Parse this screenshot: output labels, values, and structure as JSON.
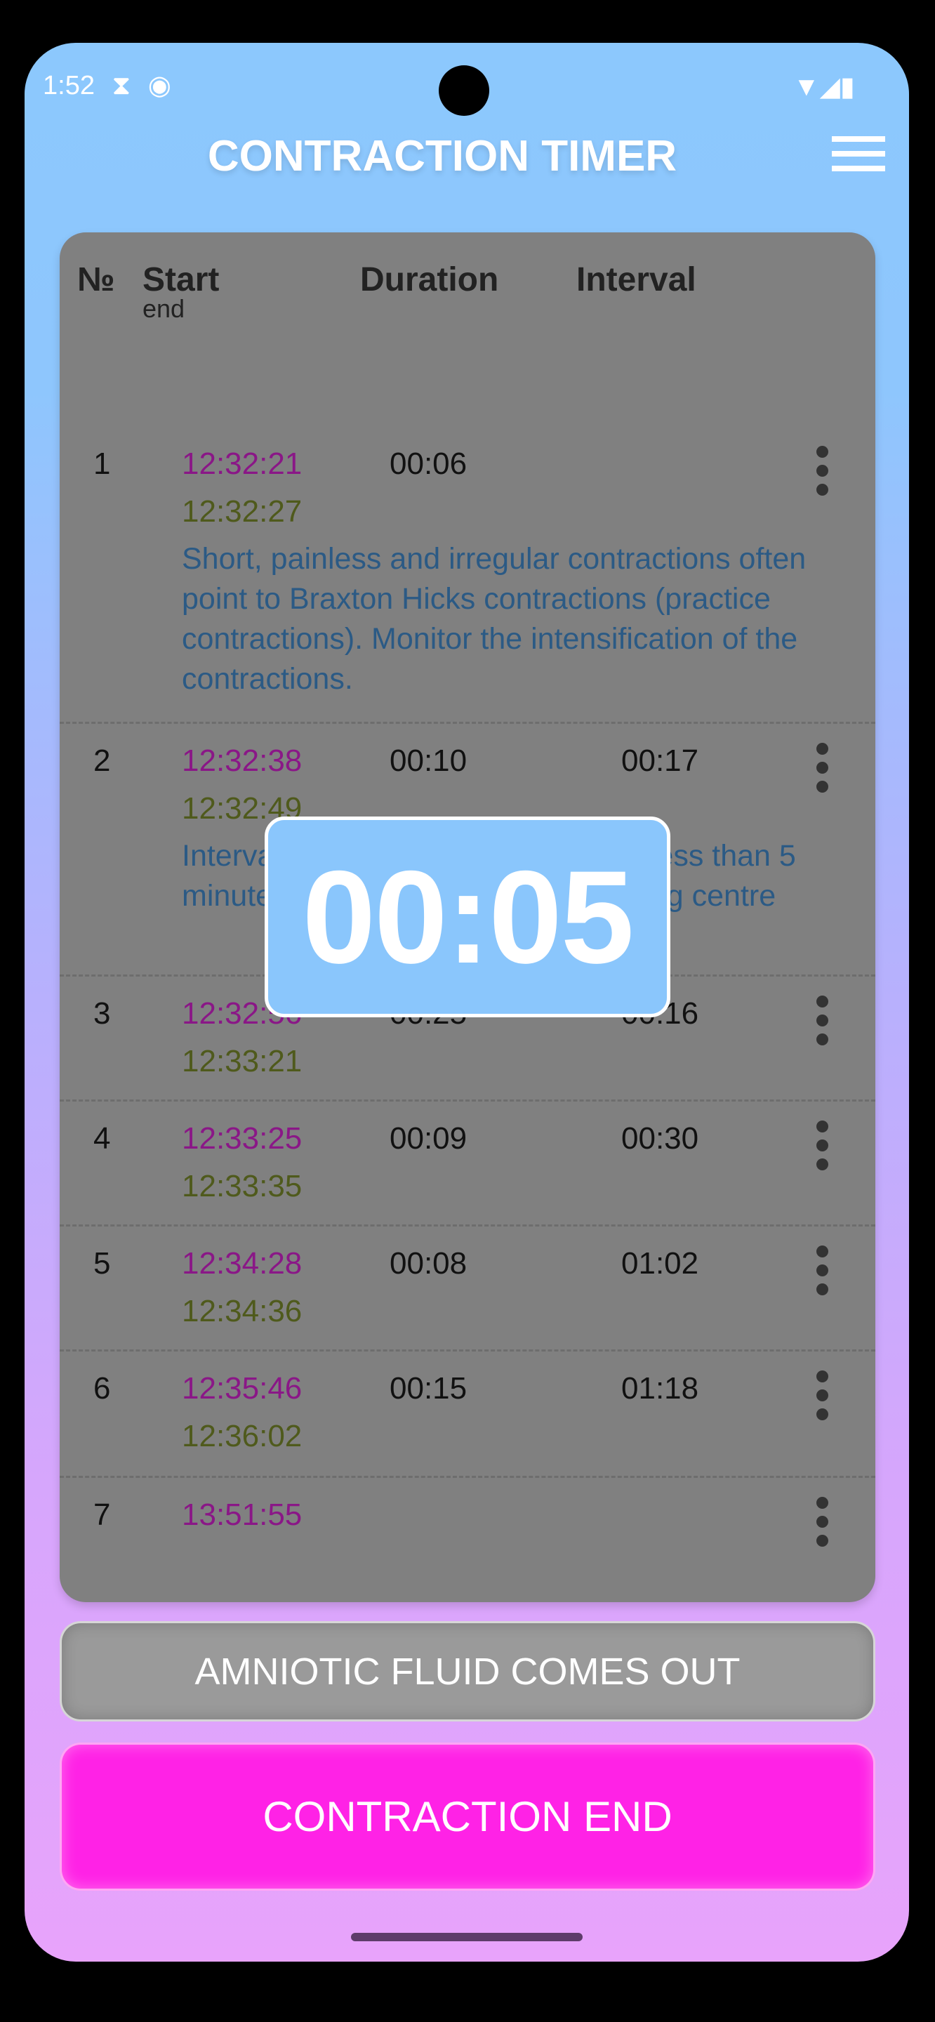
{
  "status_bar": {
    "time": "1:52",
    "icons": [
      "pregnancy-icon",
      "cast-icon",
      "wifi-icon",
      "signal-icon",
      "battery-icon"
    ]
  },
  "app_bar": {
    "title": "CONTRACTION TIMER",
    "menu_icon": "hamburger-menu-icon"
  },
  "table": {
    "headers": {
      "number": "№",
      "start": "Start",
      "end": "end",
      "duration": "Duration",
      "interval": "Interval"
    },
    "rows": [
      {
        "n": "1",
        "start": "12:32:21",
        "end": "12:32:27",
        "duration": "00:06",
        "interval": "",
        "note": "Short, painless and irregular contractions often point to Braxton Hicks contractions (practice contractions). Monitor the intensification of the contractions."
      },
      {
        "n": "2",
        "start": "12:32:38",
        "end": "12:32:49",
        "duration": "00:10",
        "interval": "00:17",
        "note": "Intervals between contractions are less than 5 minutes. Go to the hospital or birthing centre"
      },
      {
        "n": "3",
        "start": "12:32:56",
        "end": "12:33:21",
        "duration": "00:25",
        "interval": "00:16",
        "note": ""
      },
      {
        "n": "4",
        "start": "12:33:25",
        "end": "12:33:35",
        "duration": "00:09",
        "interval": "00:30",
        "note": ""
      },
      {
        "n": "5",
        "start": "12:34:28",
        "end": "12:34:36",
        "duration": "00:08",
        "interval": "01:02",
        "note": ""
      },
      {
        "n": "6",
        "start": "12:35:46",
        "end": "12:36:02",
        "duration": "00:15",
        "interval": "01:18",
        "note": ""
      },
      {
        "n": "7",
        "start": "13:51:55",
        "end": "",
        "duration": "",
        "interval": "",
        "note": ""
      }
    ]
  },
  "timer_popup": {
    "value": "00:05"
  },
  "buttons": {
    "amniotic": "AMNIOTIC FLUID COMES OUT",
    "contraction_end": "CONTRACTION END"
  },
  "colors": {
    "start_time": "#8a1787",
    "end_time": "#4f5a1c",
    "note": "#2b5a85",
    "primary_button": "#ff22e6",
    "timer_bg": "#8ac6fc"
  }
}
